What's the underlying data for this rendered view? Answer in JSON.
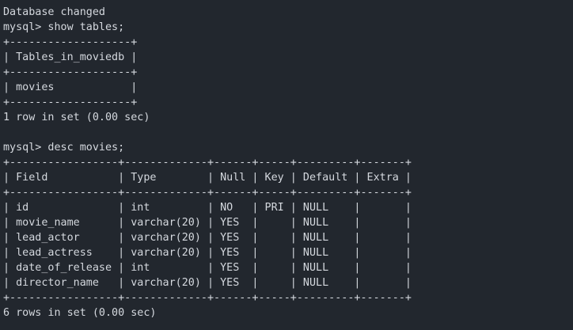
{
  "terminal": {
    "lines": [
      "Database changed",
      "mysql> show tables;",
      "+-------------------+",
      "| Tables_in_moviedb |",
      "+-------------------+",
      "| movies            |",
      "+-------------------+",
      "1 row in set (0.00 sec)",
      "",
      "mysql> desc movies;",
      "+-----------------+-------------+------+-----+---------+-------+",
      "| Field           | Type        | Null | Key | Default | Extra |",
      "+-----------------+-------------+------+-----+---------+-------+",
      "| id              | int         | NO   | PRI | NULL    |       |",
      "| movie_name      | varchar(20) | YES  |     | NULL    |       |",
      "| lead_actor      | varchar(20) | YES  |     | NULL    |       |",
      "| lead_actress    | varchar(20) | YES  |     | NULL    |       |",
      "| date_of_release | int         | YES  |     | NULL    |       |",
      "| director_name   | varchar(20) | YES  |     | NULL    |       |",
      "+-----------------+-------------+------+-----+---------+-------+",
      "6 rows in set (0.00 sec)"
    ]
  }
}
